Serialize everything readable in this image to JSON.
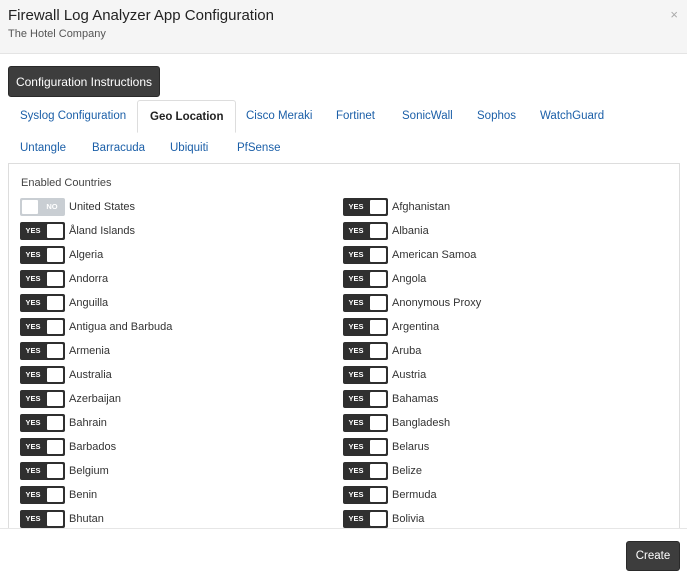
{
  "header": {
    "title": "Firewall Log Analyzer App Configuration",
    "subtitle": "The Hotel Company",
    "close_glyph": "×"
  },
  "instructions_button": "Configuration Instructions",
  "tabs": [
    {
      "label": "Syslog Configuration",
      "active": false
    },
    {
      "label": "Geo Location",
      "active": true
    },
    {
      "label": "Cisco Meraki",
      "active": false
    },
    {
      "label": "Fortinet",
      "active": false
    },
    {
      "label": "SonicWall",
      "active": false
    },
    {
      "label": "Sophos",
      "active": false
    },
    {
      "label": "WatchGuard",
      "active": false
    },
    {
      "label": "Untangle",
      "active": false
    },
    {
      "label": "Barracuda",
      "active": false
    },
    {
      "label": "Ubiquiti",
      "active": false
    },
    {
      "label": "PfSense",
      "active": false
    }
  ],
  "section_label": "Enabled Countries",
  "countries_left": [
    {
      "name": "United States",
      "state": "NO"
    },
    {
      "name": "Åland Islands",
      "state": "YES"
    },
    {
      "name": "Algeria",
      "state": "YES"
    },
    {
      "name": "Andorra",
      "state": "YES"
    },
    {
      "name": "Anguilla",
      "state": "YES"
    },
    {
      "name": "Antigua and Barbuda",
      "state": "YES"
    },
    {
      "name": "Armenia",
      "state": "YES"
    },
    {
      "name": "Australia",
      "state": "YES"
    },
    {
      "name": "Azerbaijan",
      "state": "YES"
    },
    {
      "name": "Bahrain",
      "state": "YES"
    },
    {
      "name": "Barbados",
      "state": "YES"
    },
    {
      "name": "Belgium",
      "state": "YES"
    },
    {
      "name": "Benin",
      "state": "YES"
    },
    {
      "name": "Bhutan",
      "state": "YES"
    }
  ],
  "countries_right": [
    {
      "name": "Afghanistan",
      "state": "YES"
    },
    {
      "name": "Albania",
      "state": "YES"
    },
    {
      "name": "American Samoa",
      "state": "YES"
    },
    {
      "name": "Angola",
      "state": "YES"
    },
    {
      "name": "Anonymous Proxy",
      "state": "YES"
    },
    {
      "name": "Argentina",
      "state": "YES"
    },
    {
      "name": "Aruba",
      "state": "YES"
    },
    {
      "name": "Austria",
      "state": "YES"
    },
    {
      "name": "Bahamas",
      "state": "YES"
    },
    {
      "name": "Bangladesh",
      "state": "YES"
    },
    {
      "name": "Belarus",
      "state": "YES"
    },
    {
      "name": "Belize",
      "state": "YES"
    },
    {
      "name": "Bermuda",
      "state": "YES"
    },
    {
      "name": "Bolivia",
      "state": "YES"
    }
  ],
  "footer": {
    "create_label": "Create"
  },
  "colors": {
    "toggle_on": "#2f2f2f",
    "toggle_off": "#c9ced3",
    "tab_link": "#1b5fa8",
    "button_dark": "#3d3d3d"
  }
}
